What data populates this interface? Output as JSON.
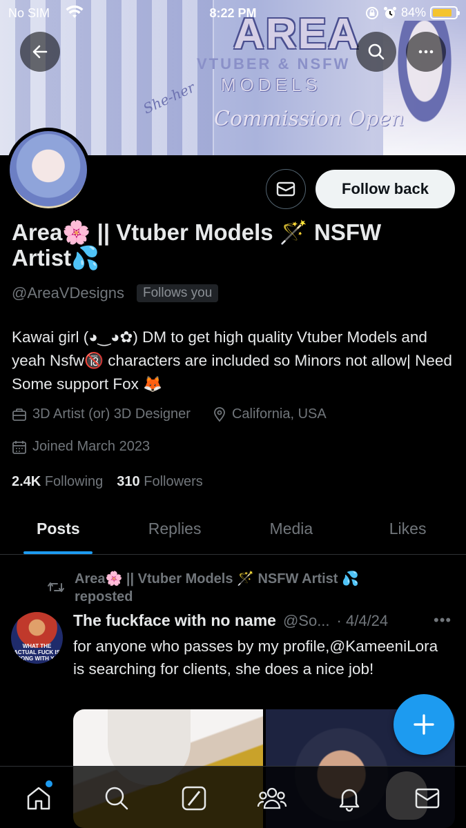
{
  "status_bar": {
    "carrier": "No SIM",
    "time": "8:22 PM",
    "battery": "84%",
    "battery_level": 0.84
  },
  "banner": {
    "title": "AREA",
    "subtitle": "VTUBER & NSFW",
    "models": "MODELS",
    "commission": "Commission Open",
    "pronouns": "She-her"
  },
  "header": {
    "back_icon": "back-arrow-icon",
    "search_icon": "search-icon",
    "more_icon": "more-icon"
  },
  "profile": {
    "name": "Area🌸 || Vtuber Models 🪄 NSFW Artist💦",
    "handle": "@AreaVDesigns",
    "follows_you": "Follows you",
    "bio": "Kawai girl (◕‿◕✿) DM to get high quality Vtuber Models and yeah Nsfw🔞 characters are included so Minors not allow| Need Some support Fox 🦊",
    "category": "3D Artist (or) 3D Designer",
    "location": "California, USA",
    "joined": "Joined March 2023",
    "following_count": "2.4K",
    "following_label": "Following",
    "followers_count": "310",
    "followers_label": "Followers",
    "follow_button": "Follow back"
  },
  "tabs": [
    "Posts",
    "Replies",
    "Media",
    "Likes"
  ],
  "active_tab": "Posts",
  "post": {
    "repost_text": "Area🌸 || Vtuber Models 🪄 NSFW Artist 💦 reposted",
    "author": "The fuckface with no name",
    "handle": "@So...",
    "date": "· 4/4/24",
    "more": "•••",
    "avatar_caption": "WHAT THE ACTUAL FUCK IS WRONG WITH YOU",
    "text": "for anyone who passes by my profile,@KameeniLora is searching for clients, she does a nice job!"
  },
  "bottom_nav": [
    "home-icon",
    "search-icon",
    "grok-icon",
    "communities-icon",
    "notifications-icon",
    "messages-icon"
  ],
  "colors": {
    "accent": "#1d9bf0",
    "background": "#000000",
    "muted": "#71767b",
    "text": "#e7e9ea"
  }
}
